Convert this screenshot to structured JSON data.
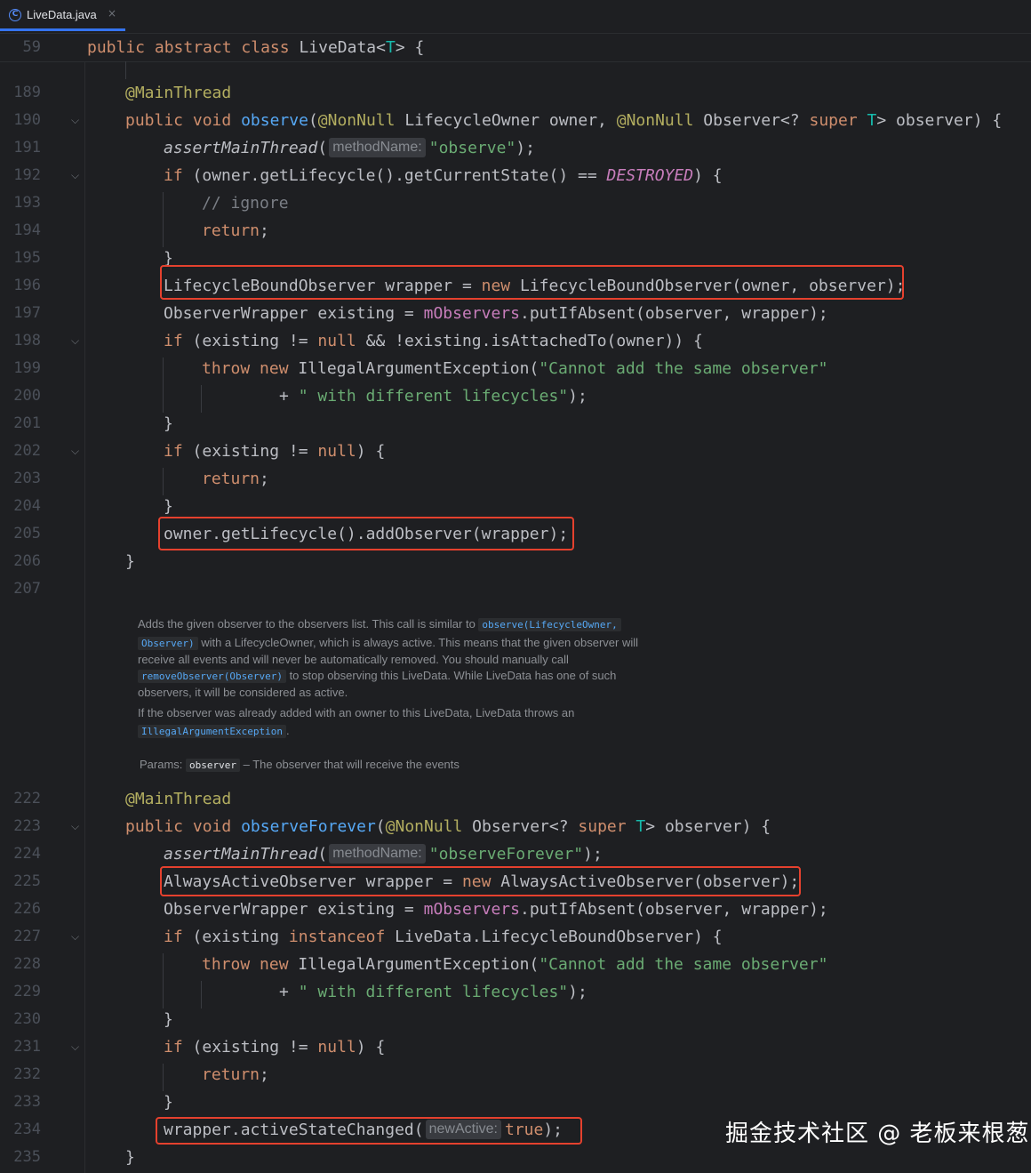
{
  "tab": {
    "title": "LiveData.java",
    "close": "×"
  },
  "sticky": {
    "line_no": "59",
    "kw1": "public",
    "kw2": "abstract",
    "kw3": "class",
    "name": "LiveData<",
    "tp": "T",
    "rest": "> {"
  },
  "lines": {
    "189": {
      "n": "189",
      "ann": "@MainThread"
    },
    "190": {
      "n": "190",
      "kw1": "public",
      "kw2": "void",
      "fn": "observe",
      "a1": "@NonNull",
      "t1": " LifecycleOwner owner, ",
      "a2": "@NonNull",
      "t2": " Observer<? ",
      "kw3": "super",
      "tp": " T",
      "t3": "> observer) {"
    },
    "191": {
      "n": "191",
      "fn": "assertMainThread",
      "p": "(",
      "hint": "methodName:",
      "str": "\"observe\"",
      "end": ");"
    },
    "192": {
      "n": "192",
      "kw": "if",
      "t1": " (owner.getLifecycle().getCurrentState() == ",
      "c": "DESTROYED",
      "t2": ") {"
    },
    "193": {
      "n": "193",
      "cm": "// ignore"
    },
    "194": {
      "n": "194",
      "kw": "return",
      "end": ";"
    },
    "195": {
      "n": "195",
      "t": "}"
    },
    "196": {
      "n": "196",
      "t1": "LifecycleBoundObserver wrapper = ",
      "kw": "new",
      "t2": " LifecycleBoundObserver(owner, observer);"
    },
    "197": {
      "n": "197",
      "t1": "ObserverWrapper existing = ",
      "fld": "mObservers",
      "t2": ".putIfAbsent(observer, wrapper);"
    },
    "198": {
      "n": "198",
      "kw": "if",
      "t1": " (existing != ",
      "kw2": "null",
      "t2": " && !existing.isAttachedTo(owner)) {"
    },
    "199": {
      "n": "199",
      "kw1": "throw",
      "kw2": "new",
      "t1": " IllegalArgumentException(",
      "str": "\"Cannot add the same observer\""
    },
    "200": {
      "n": "200",
      "t1": "+ ",
      "str": "\" with different lifecycles\"",
      "t2": ");"
    },
    "201": {
      "n": "201",
      "t": "}"
    },
    "202": {
      "n": "202",
      "kw": "if",
      "t1": " (existing != ",
      "kw2": "null",
      "t2": ") {"
    },
    "203": {
      "n": "203",
      "kw": "return",
      "end": ";"
    },
    "204": {
      "n": "204",
      "t": "}"
    },
    "205": {
      "n": "205",
      "t": "owner.getLifecycle().addObserver(wrapper);"
    },
    "206": {
      "n": "206",
      "t": "}"
    },
    "207": {
      "n": "207"
    },
    "222": {
      "n": "222",
      "ann": "@MainThread"
    },
    "223": {
      "n": "223",
      "kw1": "public",
      "kw2": "void",
      "fn": "observeForever",
      "a1": "@NonNull",
      "t1": " Observer<? ",
      "kw3": "super",
      "tp": " T",
      "t2": "> observer) {"
    },
    "224": {
      "n": "224",
      "fn": "assertMainThread",
      "p": "(",
      "hint": "methodName:",
      "str": "\"observeForever\"",
      "end": ");"
    },
    "225": {
      "n": "225",
      "t1": "AlwaysActiveObserver wrapper = ",
      "kw": "new",
      "t2": " AlwaysActiveObserver(observer);"
    },
    "226": {
      "n": "226",
      "t1": "ObserverWrapper existing = ",
      "fld": "mObservers",
      "t2": ".putIfAbsent(observer, wrapper);"
    },
    "227": {
      "n": "227",
      "kw": "if",
      "t1": " (existing ",
      "kw2": "instanceof",
      "t2": " LiveData.LifecycleBoundObserver) {"
    },
    "228": {
      "n": "228",
      "kw1": "throw",
      "kw2": "new",
      "t1": " IllegalArgumentException(",
      "str": "\"Cannot add the same observer\""
    },
    "229": {
      "n": "229",
      "t1": "+ ",
      "str": "\" with different lifecycles\"",
      "t2": ");"
    },
    "230": {
      "n": "230",
      "t": "}"
    },
    "231": {
      "n": "231",
      "kw": "if",
      "t1": " (existing != ",
      "kw2": "null",
      "t2": ") {"
    },
    "232": {
      "n": "232",
      "kw": "return",
      "end": ";"
    },
    "233": {
      "n": "233",
      "t": "}"
    },
    "234": {
      "n": "234",
      "t1": "wrapper.activeStateChanged(",
      "hint": "newActive:",
      "kw": "true",
      "t2": ");"
    },
    "235": {
      "n": "235",
      "t": "}"
    }
  },
  "doc": {
    "p1a": "Adds the given observer to the observers list. This call is similar to ",
    "p1code": "observe(LifecycleOwner,",
    "p2code": "Observer)",
    "p2a": " with a LifecycleOwner, which is always active. This means that the given observer will",
    "p3": "receive all events and will never be automatically removed. You should manually call",
    "p4code": "removeObserver(Observer)",
    "p4a": " to stop observing this LiveData. While LiveData has one of such",
    "p5": "observers, it will be considered as active.",
    "p6": "If the observer was already added with an owner to this LiveData, LiveData throws an",
    "p7code": "IllegalArgumentException",
    "p7a": ".",
    "params_label": "Params:",
    "params_code": "observer",
    "params_desc": " – The observer that will receive the events"
  },
  "watermark": "掘金技术社区 @ 老板来根葱",
  "colors": {
    "highlight_box": "#e5412e",
    "keyword": "#cf8e6d",
    "annotation": "#b3ae60",
    "method": "#56a8f5",
    "string": "#6aab73"
  }
}
